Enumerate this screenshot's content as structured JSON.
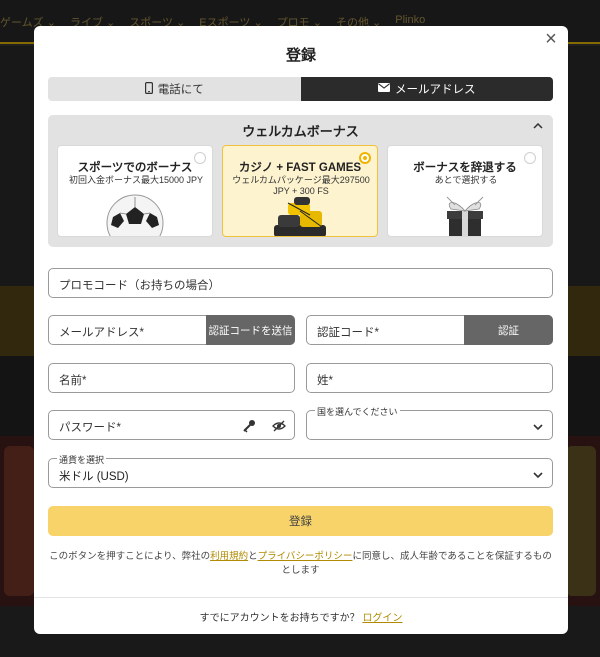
{
  "background": {
    "nav_items": [
      "ゲームズ ⌄",
      "ライブ ⌄",
      "スポーツ ⌄",
      "Eスポーツ ⌄",
      "プロモ ⌄",
      "その他 ⌄",
      "Plinko"
    ]
  },
  "modal": {
    "title": "登録",
    "close_label": "×",
    "tabs": [
      {
        "label": "電話にて",
        "icon": "phone-icon",
        "active": false
      },
      {
        "label": "メールアドレス",
        "icon": "mail-icon",
        "active": true
      }
    ],
    "bonus": {
      "header": "ウェルカムボーナス",
      "cards": [
        {
          "title": "スポーツでのボーナス",
          "subtitle": "初回入金ボーナス最大15000 JPY",
          "icon": "soccer-ball-icon",
          "selected": false
        },
        {
          "title": "カジノ + FAST GAMES",
          "subtitle": "ウェルカムパッケージ最大297500 JPY + 300 FS",
          "icon": "casino-chips-icon",
          "selected": true
        },
        {
          "title": "ボーナスを辞退する",
          "subtitle": "あとで選択する",
          "icon": "gift-box-icon",
          "selected": false
        }
      ]
    },
    "fields": {
      "promo": "プロモコード（お持ちの場合）",
      "email": "メールアドレス*",
      "send_code": "認証コードを送信",
      "code": "認証コード*",
      "verify": "認証",
      "first_name": "名前*",
      "last_name": "姓*",
      "password": "パスワード*",
      "country_label": "国を選んでください",
      "country_value": "",
      "currency_label": "通貨を選択",
      "currency_value": "米ドル (USD)"
    },
    "submit": "登録",
    "terms": {
      "prefix": "このボタンを押すことにより、弊社の",
      "link1": "利用規約",
      "mid": "と",
      "link2": "プライバシーポリシー",
      "suffix": "に同意し、成人年齢であることを保証するものとします"
    },
    "footer": {
      "text": "すでにアカウントをお持ちですか？",
      "link": "ログイン"
    }
  },
  "colors": {
    "accent": "#f0b400",
    "submit_bg": "#f7d36a",
    "tab_active": "#2b2b2b",
    "link": "#b08a00"
  }
}
